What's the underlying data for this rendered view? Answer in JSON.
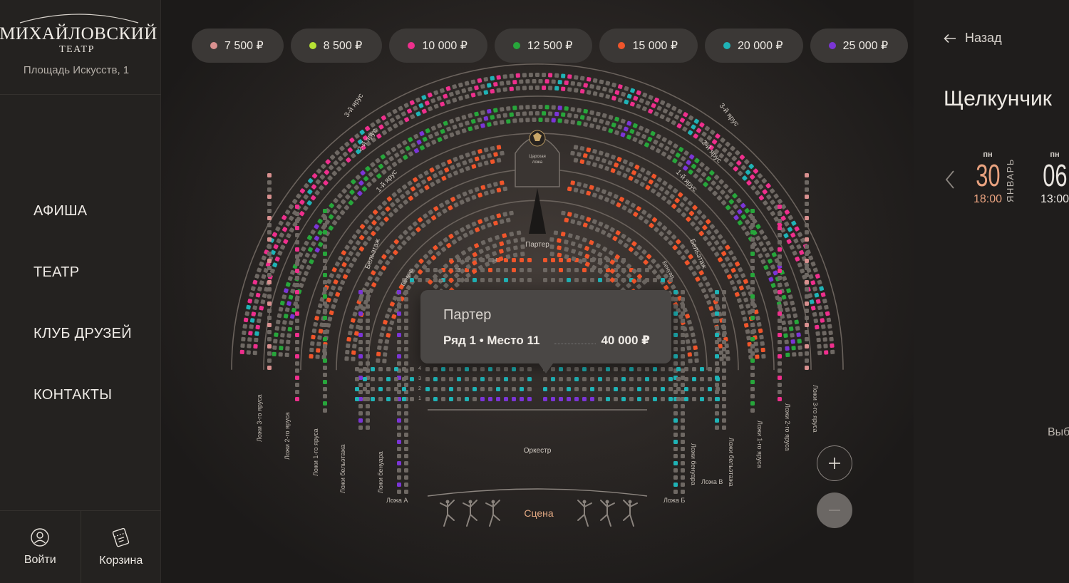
{
  "sidebar": {
    "logo": {
      "name": "МИХАЙЛОВСКИЙ",
      "subtitle": "ТЕАТР"
    },
    "address": "Площадь Искусств, 1",
    "nav": [
      {
        "label": "АФИША"
      },
      {
        "label": "ТЕАТР"
      },
      {
        "label": "КЛУБ ДРУЗЕЙ"
      },
      {
        "label": "КОНТАКТЫ"
      }
    ],
    "login_label": "Войти",
    "cart_label": "Корзина"
  },
  "prices": [
    {
      "label": "7 500 ₽",
      "color": "#d9908f"
    },
    {
      "label": "8 500 ₽",
      "color": "#b7e234"
    },
    {
      "label": "10 000 ₽",
      "color": "#ee2f8d"
    },
    {
      "label": "12 500 ₽",
      "color": "#27a63b"
    },
    {
      "label": "15 000 ₽",
      "color": "#f0552b"
    },
    {
      "label": "20 000 ₽",
      "color": "#1fb3b6"
    },
    {
      "label": "25 000 ₽",
      "color": "#7b35d6"
    }
  ],
  "hall": {
    "tiers": {
      "tier3_left": "3-й ярус",
      "tier2_left": "2-й ярус",
      "tier1_left": "1-й ярус",
      "tier3_right": "3-й ярус",
      "tier2_right": "2-й ярус",
      "tier1_right": "1-й ярус",
      "beletage_left": "Бельэтаж",
      "beletage_right": "Бельэтаж",
      "benoir_left": "Бенуар",
      "benoir_right": "Бенуар",
      "parterre": "Партер",
      "royal_box_line1": "Царская",
      "royal_box_line2": "ложа"
    },
    "boxes": {
      "left_tier3": "Ложи 3-го яруса",
      "left_tier2": "Ложи 2-го яруса",
      "left_tier1": "Ложи 1-го яруса",
      "left_beletage": "Ложи бельэтажа",
      "left_benoir": "Ложи бенуара",
      "right_benoir": "Ложи бенуара",
      "right_beletage": "Ложи бельэтажа",
      "right_tier1": "Ложи 1-го яруса",
      "right_tier2": "Ложи 2-го яруса",
      "right_tier3": "Ложи 3-го яруса",
      "box_a": "Ложа А",
      "box_b": "Ложа Б",
      "box_v": "Ложа В"
    },
    "orchestra": "Оркестр",
    "stage": "Сцена",
    "parterre_rows": {
      "row14": "14",
      "row13": "13",
      "row12": "12",
      "row4": "4",
      "row3": "3",
      "row2": "2",
      "row1": "1"
    }
  },
  "tooltip": {
    "section": "Партер",
    "seat": "Ряд 1 • Место 11",
    "price": "40 000 ₽"
  },
  "zoom": {
    "in": "+",
    "out": "−"
  },
  "panel": {
    "back_label": "Назад",
    "title": "Щелкунчик",
    "month": "ЯНВАРЬ",
    "dates": [
      {
        "dow": "пн",
        "day": "30",
        "time": "18:00",
        "color": "#e9a27f"
      },
      {
        "dow": "пн",
        "day": "06",
        "time": "13:00",
        "color": "#e8e4df"
      }
    ],
    "select_hint": "Выб"
  }
}
